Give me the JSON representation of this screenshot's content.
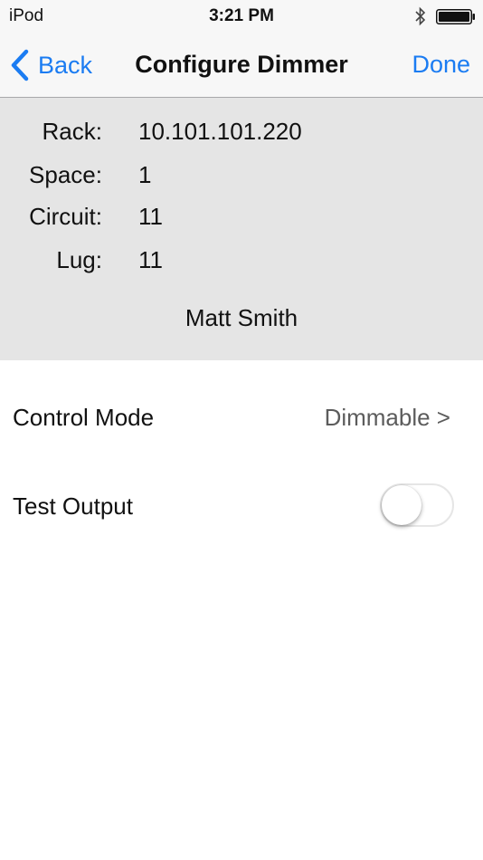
{
  "status_bar": {
    "carrier": "iPod",
    "time": "3:21 PM"
  },
  "nav": {
    "back_label": "Back",
    "title": "Configure Dimmer",
    "done_label": "Done"
  },
  "info": {
    "rack_label": "Rack:",
    "rack_value": "10.101.101.220",
    "space_label": "Space:",
    "space_value": "1",
    "circuit_label": "Circuit:",
    "circuit_value": "11",
    "lug_label": "Lug:",
    "lug_value": "11",
    "name": "Matt Smith"
  },
  "settings": {
    "control_mode_label": "Control Mode",
    "control_mode_value": "Dimmable >",
    "test_output_label": "Test Output",
    "test_output_on": false
  },
  "colors": {
    "accent": "#1b7cf2",
    "panel_bg": "#e5e5e5",
    "bar_bg": "#f7f7f7",
    "secondary_text": "#5c5c5c"
  }
}
